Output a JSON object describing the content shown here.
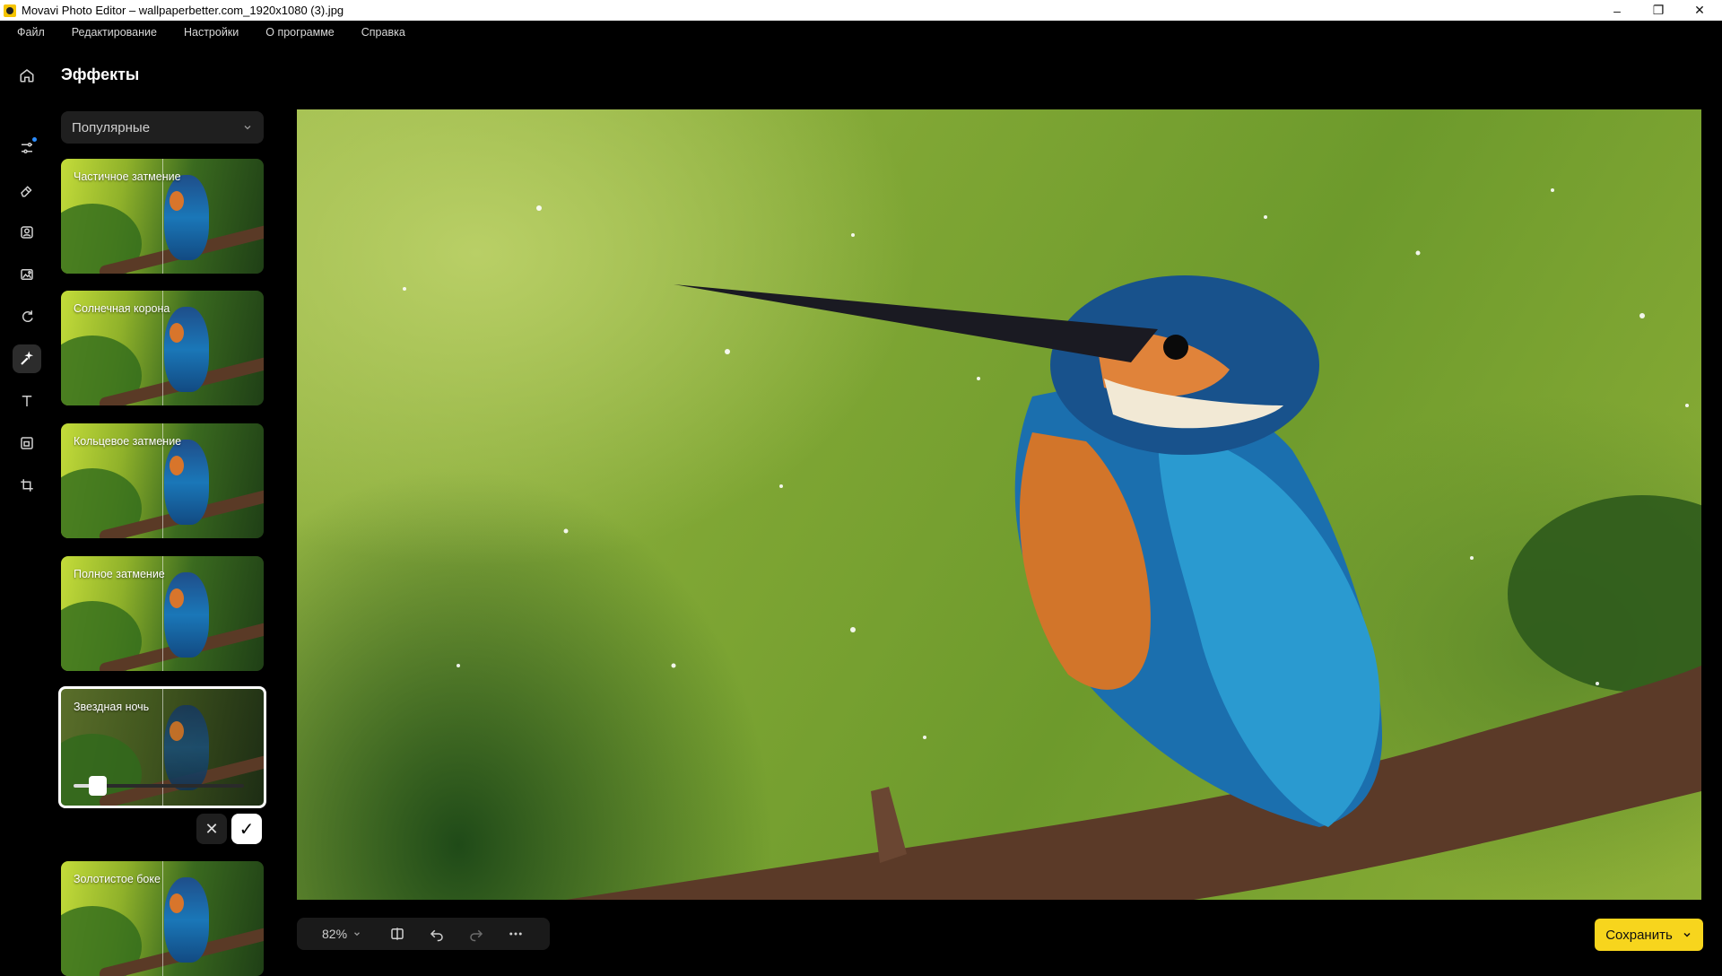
{
  "window": {
    "title": "Movavi Photo Editor – wallpaperbetter.com_1920x1080 (3).jpg",
    "controls": {
      "minimize": "–",
      "maximize": "❐",
      "close": "✕"
    }
  },
  "menu": [
    "Файл",
    "Редактирование",
    "Настройки",
    "О программе",
    "Справка"
  ],
  "rail": [
    {
      "icon": "home-icon"
    },
    {
      "icon": "adjust-sliders-icon",
      "badge": true
    },
    {
      "icon": "eraser-icon"
    },
    {
      "icon": "portrait-icon"
    },
    {
      "icon": "image-replace-icon"
    },
    {
      "icon": "rotate-icon"
    },
    {
      "icon": "effects-wand-icon",
      "active": true
    },
    {
      "icon": "text-icon"
    },
    {
      "icon": "frame-icon"
    },
    {
      "icon": "crop-icon"
    }
  ],
  "panel": {
    "title": "Эффекты",
    "category": "Популярные",
    "effects": [
      {
        "label": "Частичное затмение"
      },
      {
        "label": "Солнечная корона"
      },
      {
        "label": "Кольцевое затмение"
      },
      {
        "label": "Полное затмение"
      },
      {
        "label": "Звездная ночь",
        "selected": true,
        "intensity": 0.14
      },
      {
        "label": "Золотистое боке"
      }
    ],
    "cancel_icon": "✕",
    "apply_icon": "✓"
  },
  "toolbar": {
    "zoom": "82%",
    "compare_icon": "compare-icon",
    "undo_icon": "undo-icon",
    "redo_icon": "redo-icon",
    "more_icon": "more-icon"
  },
  "save_button": {
    "label": "Сохранить"
  },
  "colors": {
    "accent": "#f7d51d",
    "background": "#000000",
    "panel": "#1f1f1f",
    "badge": "#2b8cff"
  }
}
